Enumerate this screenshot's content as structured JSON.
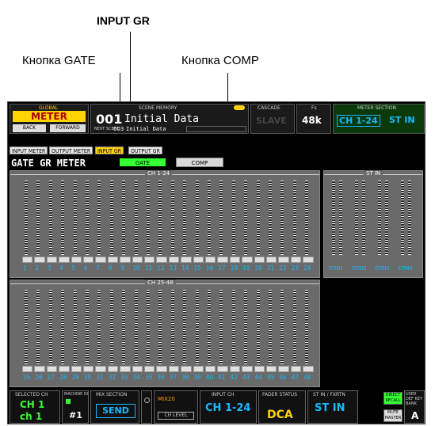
{
  "annotations": {
    "input_gr": "INPUT GR",
    "gate_button": "Кнопка GATE",
    "comp_button": "Кнопка COMP"
  },
  "header": {
    "global_label": "GLOBAL",
    "mode": "METER",
    "back": "BACK",
    "forward": "FORWARD",
    "scene_memory_label": "SCENE MEMORY",
    "scene_number": "001",
    "scene_title": "Initial Data",
    "next_label": "NEXT SCENE",
    "next_number": "003",
    "next_title": "Initial Data",
    "cascade_label": "CASCADE",
    "cascade_value": "SLAVE",
    "fs_label": "Fs",
    "fs_value": "48k",
    "meter_section_label": "METER SECTION",
    "meter_section_ch": "CH 1-24",
    "meter_section_st": "ST IN"
  },
  "tabs": [
    {
      "label": "INPUT METER"
    },
    {
      "label": "OUTPUT METER"
    },
    {
      "label": "INPUT GR"
    },
    {
      "label": "OUTPUT GR"
    }
  ],
  "page_title": "GATE GR METER",
  "gate_button": "GATE",
  "comp_button": "COMP",
  "section_ch1": "CH 1-24",
  "section_st": "ST IN",
  "section_ch25": "CH 25-48",
  "channels_top": [
    "1",
    "2",
    "3",
    "4",
    "5",
    "6",
    "7",
    "8",
    "9",
    "10",
    "11",
    "12",
    "13",
    "14",
    "15",
    "16",
    "17",
    "18",
    "19",
    "20",
    "21",
    "22",
    "23",
    "24"
  ],
  "channels_st": [
    "STIN1",
    "STIN2",
    "STIN3",
    "STIN4"
  ],
  "channels_bottom": [
    "25",
    "26",
    "27",
    "28",
    "29",
    "30",
    "31",
    "32",
    "33",
    "34",
    "35",
    "36",
    "37",
    "38",
    "39",
    "40",
    "41",
    "42",
    "43",
    "44",
    "45",
    "46",
    "47",
    "48"
  ],
  "bottom": {
    "selected_ch_label": "SELECTED CH",
    "selected_ch": "CH 1",
    "selected_ch_name": "ch 1",
    "machine_id_label": "MACHINE ID",
    "machine_id": "#1",
    "mix_section_label": "MIX SECTION",
    "mix_section": "SEND",
    "mix_number": "MIX20",
    "ch_level": "CH LEVEL",
    "input_ch_label": "INPUT CH",
    "input_ch": "CH 1-24",
    "fader_status_label": "FADER STATUS",
    "fader_status": "DCA",
    "stin_fxrtn_label": "ST IN / FXRTN",
    "stin": "ST IN",
    "direct_recall": "DIRECT RECALL",
    "mute_master": "MUTE MASTER",
    "user_def_label": "USER DEF KEY BANK",
    "user_def_value": "A"
  },
  "colors": {
    "accent_yellow": "#ffd400",
    "accent_cyan": "#19b8ff",
    "gate_green": "#33ff33",
    "meter_panel": "#6a6a6a"
  }
}
